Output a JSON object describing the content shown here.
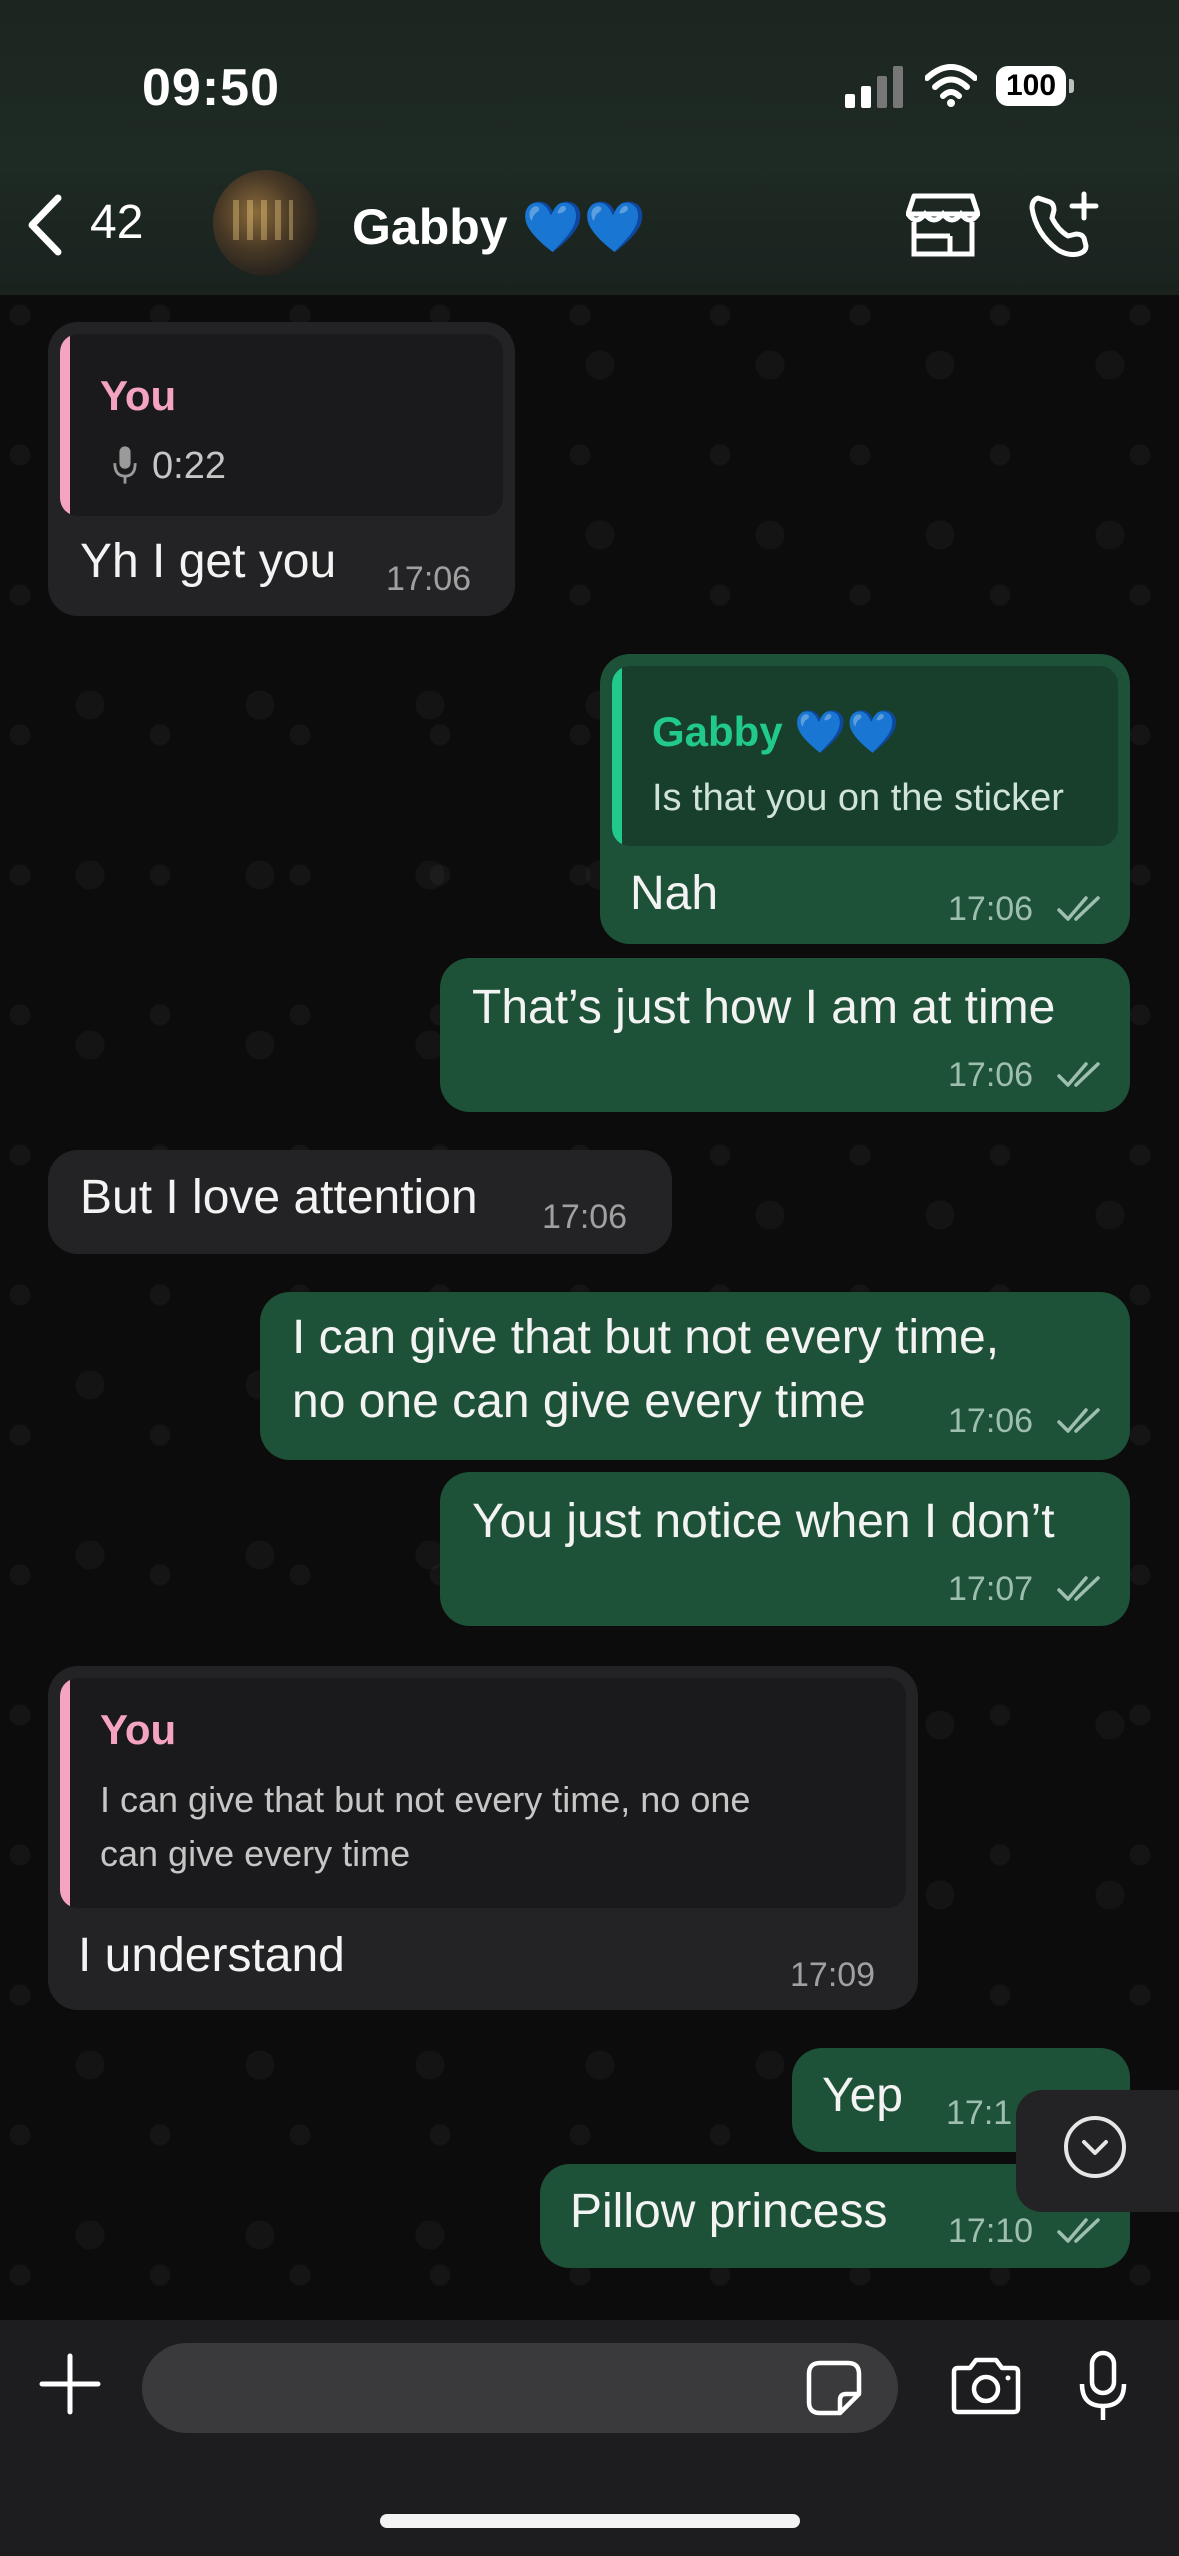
{
  "status_bar": {
    "time": "09:50",
    "battery": "100"
  },
  "header": {
    "back_count": "42",
    "contact_name": "Gabby 💙💙"
  },
  "messages": [
    {
      "direction": "in",
      "quote_author": "You",
      "quote_audio_duration": "0:22",
      "text": "Yh I get you",
      "time": "17:06"
    },
    {
      "direction": "out",
      "quote_author": "Gabby 💙💙",
      "quote_text": "Is that you on the sticker",
      "text": "Nah",
      "time": "17:06"
    },
    {
      "direction": "out",
      "text": "That’s just how I am at time",
      "time": "17:06"
    },
    {
      "direction": "in",
      "text": "But I love attention",
      "time": "17:06"
    },
    {
      "direction": "out",
      "text_line1": "I can give that but not every time,",
      "text_line2": "no one can give every time",
      "time": "17:06"
    },
    {
      "direction": "out",
      "text": "You just notice when I don’t",
      "time": "17:07"
    },
    {
      "direction": "in",
      "quote_author": "You",
      "quote_line1": "I can give that but not every time, no one",
      "quote_line2": "can give every time",
      "text": "I understand",
      "time": "17:09"
    },
    {
      "direction": "out",
      "text": "Yep",
      "time": "17:1"
    },
    {
      "direction": "out",
      "text": "Pillow princess",
      "time": "17:10"
    }
  ],
  "composer": {
    "placeholder": ""
  },
  "icons": {
    "back": "chevron-left-icon",
    "shop": "storefront-icon",
    "call": "phone-add-icon",
    "plus": "plus-icon",
    "sticker": "sticker-icon",
    "camera": "camera-icon",
    "mic": "microphone-icon",
    "scroll_down": "chevron-down-icon",
    "read_receipt": "double-check-icon"
  },
  "colors": {
    "incoming_bubble": "#232325",
    "outgoing_bubble": "#1d5238",
    "quote_you": "#f4a3c0",
    "quote_gabby": "#21c98b"
  }
}
